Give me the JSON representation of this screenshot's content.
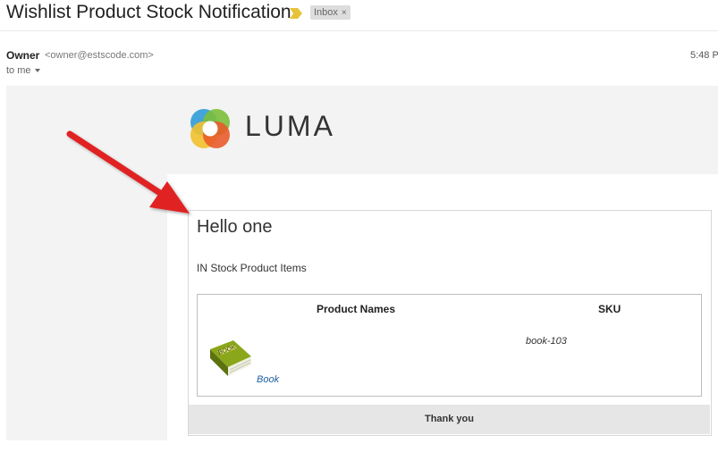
{
  "header": {
    "subject": "Wishlist Product Stock Notification",
    "label": "Inbox",
    "label_close": "×"
  },
  "message": {
    "sender_name": "Owner",
    "sender_email": "<owner@estscode.com>",
    "time": "5:48 P",
    "recipient": "to me"
  },
  "email": {
    "brand": "LUMA",
    "greeting": "Hello one",
    "section_title": "IN Stock Product Items",
    "table": {
      "headers": [
        "Product Names",
        "SKU"
      ],
      "rows": [
        {
          "name": "Book",
          "sku": "book-103"
        }
      ]
    },
    "footer": "Thank you"
  },
  "colors": {
    "arrow": "#e02020",
    "link": "#1f5f9f",
    "logo": [
      "#3aa0d8",
      "#7cbf3b",
      "#f2c12e",
      "#e85c2b"
    ]
  },
  "icons": {
    "importance": "importance-marker-icon",
    "book": "book-product-image",
    "annotation": "red-arrow-annotation"
  }
}
